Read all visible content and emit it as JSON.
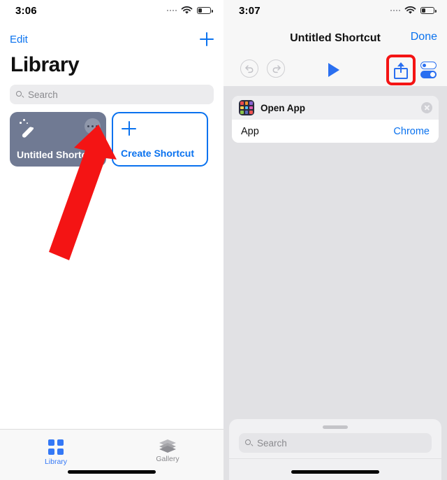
{
  "left_panel": {
    "status_bar": {
      "time": "3:06",
      "signal_icon": "signal-dots-icon",
      "wifi_icon": "wifi-icon",
      "battery_icon": "battery-low-icon"
    },
    "navbar": {
      "edit_label": "Edit",
      "add_icon": "plus-icon"
    },
    "page_title": "Library",
    "search": {
      "placeholder": "Search",
      "icon": "search-icon"
    },
    "cards": [
      {
        "name": "Untitled Shortcut",
        "icon": "magic-wand-icon",
        "menu_icon": "ellipsis-icon",
        "bg_color": "#707a93"
      },
      {
        "name": "Create Shortcut",
        "icon": "plus-icon",
        "accent_color": "#0a72ef"
      }
    ],
    "annotation": {
      "type": "red-arrow",
      "color": "#f41414",
      "points_to": "ellipsis-icon"
    },
    "tabbar": [
      {
        "label": "Library",
        "icon": "grid-icon",
        "active": true,
        "color": "#3478f6"
      },
      {
        "label": "Gallery",
        "icon": "layers-icon",
        "active": false,
        "color": "#8a8a8e"
      }
    ]
  },
  "right_panel": {
    "status_bar": {
      "time": "3:07",
      "signal_icon": "signal-dots-icon",
      "wifi_icon": "wifi-icon",
      "battery_icon": "battery-low-icon"
    },
    "navbar": {
      "title": "Untitled Shortcut",
      "done_label": "Done"
    },
    "toolbar": {
      "undo_icon": "undo-icon",
      "redo_icon": "redo-icon",
      "play_icon": "play-icon",
      "share_icon": "share-icon",
      "settings_icon": "toggles-icon",
      "highlight_color": "#f41414"
    },
    "action_card": {
      "icon": "app-grid-icon",
      "title": "Open App",
      "close_icon": "close-icon",
      "parameter_label": "App",
      "parameter_value": "Chrome"
    },
    "sheet": {
      "grabber_icon": "grabber-icon",
      "search": {
        "placeholder": "Search",
        "icon": "search-icon"
      }
    }
  },
  "app_grid_colors": [
    "#e94b4b",
    "#f0932b",
    "#8a63d2",
    "#f7d154",
    "#4fc3f7",
    "#e05bb0",
    "#8bc34a",
    "#5c6bc0",
    "#ef5350"
  ]
}
